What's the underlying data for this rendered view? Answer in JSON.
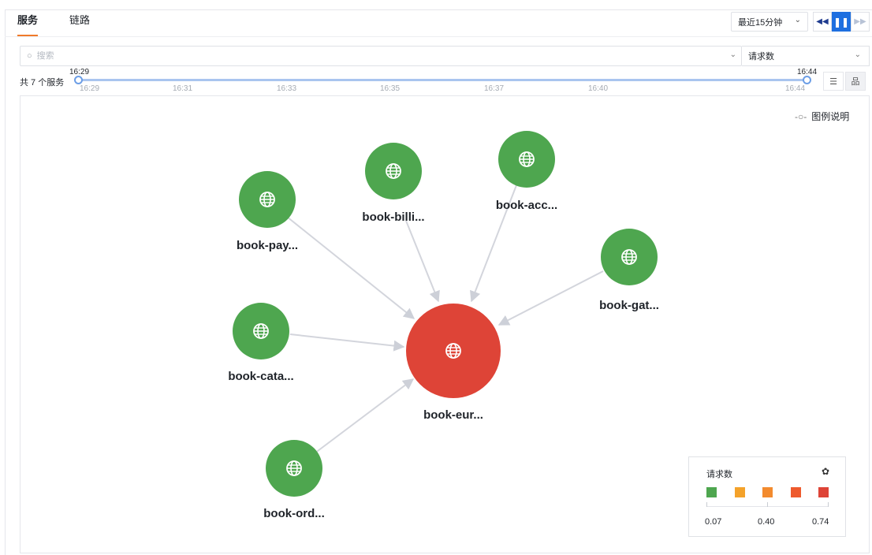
{
  "tabs": [
    {
      "label": "服务",
      "active": true
    },
    {
      "label": "链路",
      "active": false
    }
  ],
  "toolbar": {
    "time_range": "最近15分钟",
    "rewind_icon": "rewind-icon",
    "pause_icon": "pause-icon",
    "forward_icon": "fast-forward-icon",
    "rewind_glyph": "◀◀",
    "pause_glyph": "❚❚",
    "forward_glyph": "▶▶"
  },
  "search": {
    "placeholder": "搜索",
    "value": ""
  },
  "metric_select": {
    "selected": "请求数"
  },
  "summary": {
    "service_count_text": "共 7 个服务"
  },
  "timeline": {
    "start_label": "16:29",
    "end_label": "16:44",
    "ticks": [
      "16:29",
      "16:31",
      "16:33",
      "16:35",
      "16:37",
      "16:40",
      "16:44"
    ]
  },
  "legend_link": {
    "label": "图例说明"
  },
  "graph": {
    "center": {
      "name": "book-eur...",
      "color": "#de4437"
    },
    "nodes": [
      {
        "name": "book-pay...",
        "color": "#4ea64f"
      },
      {
        "name": "book-billi...",
        "color": "#4ea64f"
      },
      {
        "name": "book-acc...",
        "color": "#4ea64f"
      },
      {
        "name": "book-gat...",
        "color": "#4ea64f"
      },
      {
        "name": "book-cata...",
        "color": "#4ea64f"
      },
      {
        "name": "book-ord...",
        "color": "#4ea64f"
      }
    ],
    "edge_color": "#d3d5dc"
  },
  "scale_legend": {
    "title": "请求数",
    "colors": [
      "#4ea64f",
      "#f4a22a",
      "#f38b2e",
      "#ee5a2d",
      "#de4437"
    ],
    "values": [
      "0.07",
      "0.40",
      "0.74"
    ]
  }
}
